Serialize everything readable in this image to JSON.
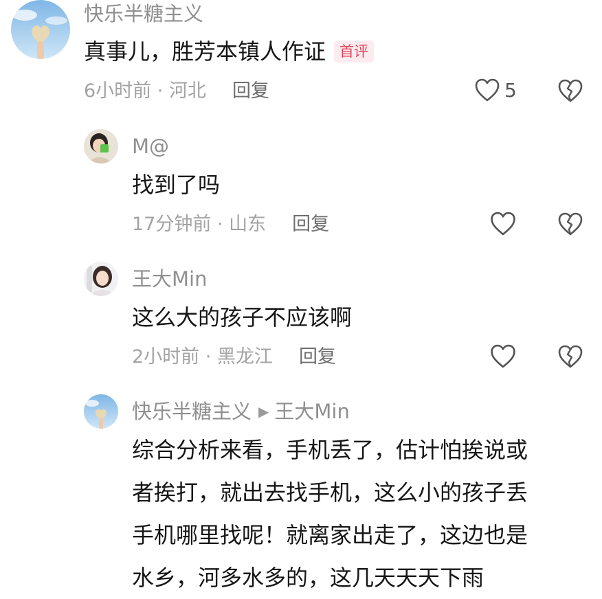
{
  "comments": [
    {
      "username": "快乐半糖主义",
      "text": "真事儿，胜芳本镇人作证",
      "badge": "首评",
      "time": "6小时前",
      "location": "河北",
      "reply_label": "回复",
      "likes": "5"
    },
    {
      "username": "M@",
      "text": "找到了吗",
      "time": "17分钟前",
      "location": "山东",
      "reply_label": "回复",
      "likes": ""
    },
    {
      "username": "王大Min",
      "text": "这么大的孩子不应该啊",
      "time": "2小时前",
      "location": "黑龙江",
      "reply_label": "回复",
      "likes": ""
    },
    {
      "username": "快乐半糖主义",
      "reply_to": "王大Min",
      "text_lines": [
        "综合分析来看，手机丢了，估计怕挨说或",
        "者挨打，就出去找手机，这么小的孩子丢",
        "手机哪里找呢！就离家出走了，这边也是",
        "水乡，河多水多的，这几天天天下雨"
      ]
    }
  ],
  "meta_separator": " · ",
  "icons": {
    "like": "heart-outline-icon",
    "dislike": "broken-heart-icon",
    "reply_arrow": "triangle-right-icon"
  }
}
